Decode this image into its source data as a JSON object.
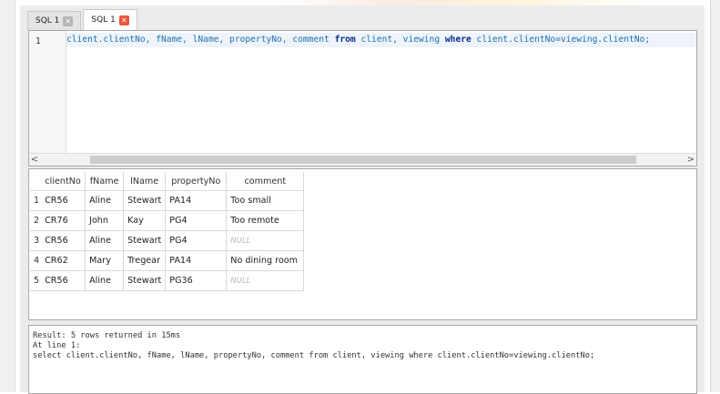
{
  "tabs": [
    {
      "label": "SQL 1",
      "active": false
    },
    {
      "label": "SQL 1",
      "active": true
    }
  ],
  "editor": {
    "line_number": "1",
    "tokens": [
      {
        "text": "client.clientNo, fName, lName, propertyNo, comment ",
        "kind": "ident"
      },
      {
        "text": "from",
        "kind": "kw"
      },
      {
        "text": " client, viewing ",
        "kind": "ident"
      },
      {
        "text": "where",
        "kind": "kw"
      },
      {
        "text": " client.clientNo=viewing.clientNo;",
        "kind": "ident"
      }
    ],
    "scroll_left": "<",
    "scroll_right": ">"
  },
  "results": {
    "columns": [
      "clientNo",
      "fName",
      "lName",
      "propertyNo",
      "comment"
    ],
    "rows": [
      {
        "num": "1",
        "cells": [
          "CR56",
          "Aline",
          "Stewart",
          "PA14",
          "Too small"
        ]
      },
      {
        "num": "2",
        "cells": [
          "CR76",
          "John",
          "Kay",
          "PG4",
          "Too remote"
        ]
      },
      {
        "num": "3",
        "cells": [
          "CR56",
          "Aline",
          "Stewart",
          "PG4",
          "NULL"
        ]
      },
      {
        "num": "4",
        "cells": [
          "CR62",
          "Mary",
          "Tregear",
          "PA14",
          "No dining room"
        ]
      },
      {
        "num": "5",
        "cells": [
          "CR56",
          "Aline",
          "Stewart",
          "PG36",
          "NULL"
        ]
      }
    ]
  },
  "log": {
    "line1": "Result: 5 rows returned in 15ms",
    "line2": "At line 1:",
    "line3": "select client.clientNo, fName, lName, propertyNo, comment from client, viewing where client.clientNo=viewing.clientNo;"
  },
  "colors": {
    "tab_close_active": "#e8573b",
    "keyword": "#0a2a8a",
    "identifier": "#1f6fb0",
    "current_line": "#eef4fa"
  }
}
